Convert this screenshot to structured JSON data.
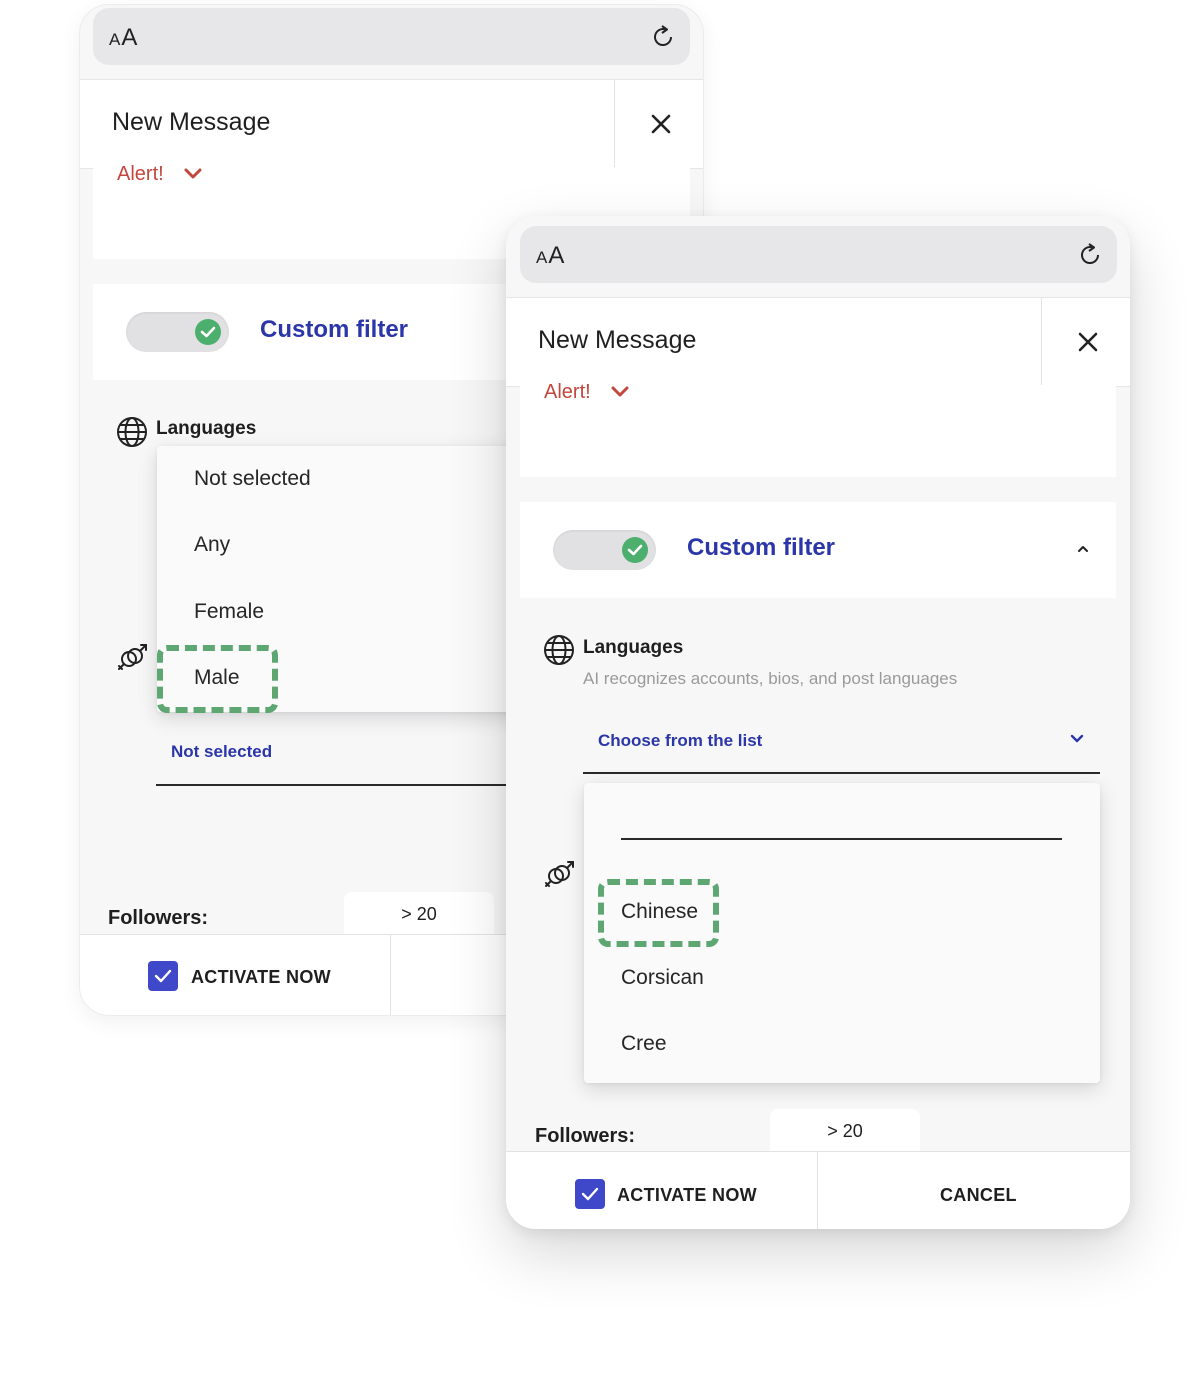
{
  "browser": {
    "text_size_label_small": "A",
    "text_size_label_large": "A"
  },
  "back_screen": {
    "header": {
      "title": "New Message"
    },
    "alert": {
      "label": "Alert!"
    },
    "filter": {
      "label": "Custom filter",
      "enabled": true
    },
    "languages": {
      "label": "Languages"
    },
    "gender_dropdown": {
      "options": [
        "Not selected",
        "Any",
        "Female",
        "Male"
      ],
      "highlighted": "Male"
    },
    "gender_select": {
      "value": "Not selected"
    },
    "followers": {
      "label": "Followers:",
      "value": "> 20"
    },
    "footer": {
      "activate_label": "ACTIVATE NOW",
      "activate_checked": true
    }
  },
  "front_screen": {
    "header": {
      "title": "New Message"
    },
    "alert": {
      "label": "Alert!"
    },
    "filter": {
      "label": "Custom filter",
      "enabled": true,
      "expanded": true
    },
    "languages": {
      "label": "Languages",
      "description": "AI recognizes accounts, bios, and post languages",
      "select_value": "Choose from the list"
    },
    "language_dropdown": {
      "search_value": "",
      "options": [
        "Chinese",
        "Corsican",
        "Cree"
      ],
      "highlighted": "Chinese"
    },
    "followers": {
      "label": "Followers:",
      "value": "> 20"
    },
    "footer": {
      "activate_label": "ACTIVATE NOW",
      "activate_checked": true,
      "cancel_label": "CANCEL"
    }
  },
  "colors": {
    "accent_blue": "#2b36a8",
    "checkbox_blue": "#3f48c9",
    "toggle_green": "#4caf6e",
    "alert_red": "#c2473c",
    "highlight_green": "#5ea772"
  }
}
